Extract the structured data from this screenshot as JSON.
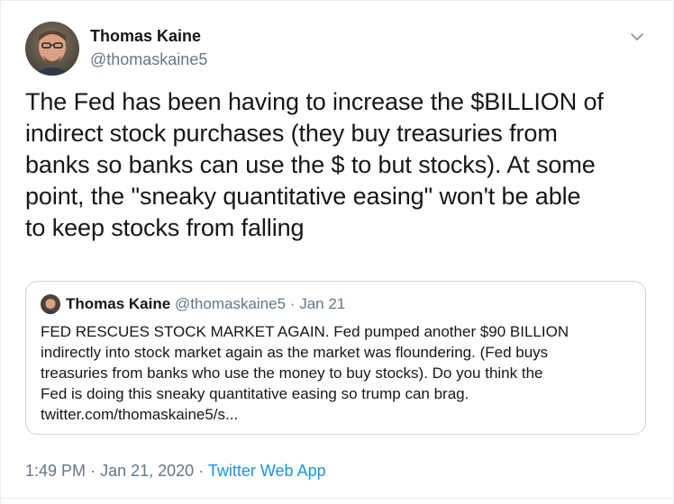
{
  "author": {
    "name": "Thomas Kaine",
    "handle": "@thomaskaine5"
  },
  "menu": {
    "icon": "chevron-down-icon"
  },
  "tweet": {
    "lines": [
      "The Fed has been having to increase the $BILLION of",
      "indirect stock purchases (they buy treasuries from",
      "banks so banks can use the $ to but stocks).  At some",
      "point, the \"sneaky quantitative easing\" won't be able",
      "to keep stocks from falling"
    ]
  },
  "quoted": {
    "name": "Thomas Kaine",
    "handle": "@thomaskaine5",
    "separator": "·",
    "date": "Jan 21",
    "lines": [
      "FED RESCUES STOCK MARKET AGAIN.  Fed pumped another $90 BILLION",
      "indirectly into stock market again as the market was floundering.   (Fed buys",
      "treasuries from banks who use the money to buy stocks).  Do you think the",
      "Fed is doing this sneaky quantitative easing so trump can brag.",
      "twitter.com/thomaskaine5/s..."
    ]
  },
  "meta": {
    "time": "1:49 PM",
    "separator": "·",
    "date": "Jan 21, 2020",
    "source": "Twitter Web App"
  },
  "colors": {
    "text": "#14171a",
    "muted": "#657786",
    "link": "#1b95e0",
    "border": "#ccd6dd"
  }
}
